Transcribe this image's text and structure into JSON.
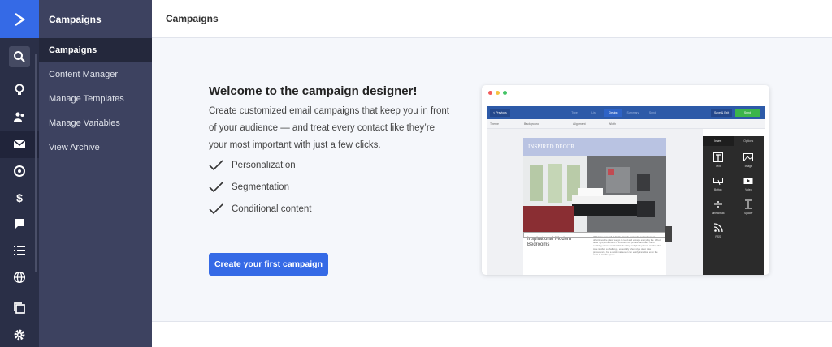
{
  "rail": {
    "logo_icon": "activecampaign-logo-icon",
    "accent_color": "#356ae6",
    "icons": [
      "search-icon",
      "lightbulb-icon",
      "contacts-icon",
      "campaigns-icon",
      "automations-icon",
      "deals-icon",
      "conversations-icon",
      "lists-icon",
      "site-icon",
      "pages-icon",
      "settings-icon"
    ]
  },
  "subnav": {
    "title": "Campaigns",
    "items": [
      {
        "label": "Campaigns"
      },
      {
        "label": "Content Manager"
      },
      {
        "label": "Manage Templates"
      },
      {
        "label": "Manage Variables"
      },
      {
        "label": "View Archive"
      }
    ]
  },
  "header": {
    "title": "Campaigns"
  },
  "main": {
    "title": "Welcome to the campaign designer!",
    "description": "Create customized email campaigns that keep you in front of your audience — and treat every contact like they’re your most important with just a few clicks.",
    "features": [
      "Personalization",
      "Segmentation",
      "Conditional content"
    ],
    "cta_label": "Create your first campaign"
  },
  "preview": {
    "prev_label": "< Previous",
    "tabs": [
      "Type",
      "List",
      "Design",
      "Summary",
      "Send"
    ],
    "save_label": "Save & Exit",
    "send_label": "Send",
    "toolbar": {
      "theme": "Theme",
      "background": "Background",
      "alignment": "Alignment",
      "width": "Width"
    },
    "email_header": "INSPIRED DECOR",
    "email_heading": "Inspirational Modern Bedrooms",
    "email_body": "With busy lives full of family, friends and work, our bedroom is oftentimes the place we go to read and escape everyday life. When done right, a bedroom is a stress free private sanctuary full of soothing colors, comfortable bedding and plush pillows. Getting that tone is often a challenge, especially when style often take precedence, but a quick makeover can easily transition even the most in-trouble space.",
    "panel_tabs": [
      "Insert",
      "Options"
    ],
    "blocks": [
      "Text",
      "Image",
      "Button",
      "Video",
      "Line Break",
      "Spacer",
      "RSS"
    ]
  }
}
